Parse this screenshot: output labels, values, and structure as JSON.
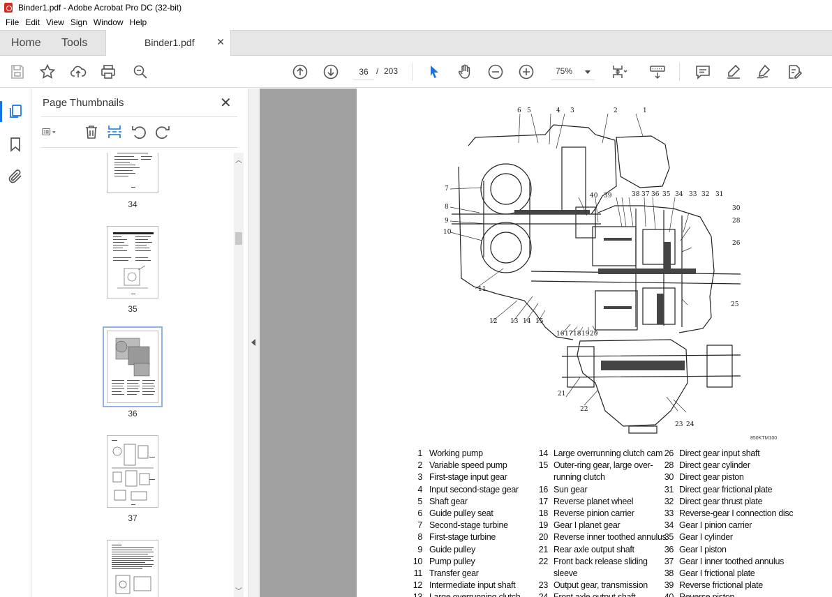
{
  "window": {
    "title": "Binder1.pdf - Adobe Acrobat Pro DC (32-bit)"
  },
  "menu": [
    "File",
    "Edit",
    "View",
    "Sign",
    "Window",
    "Help"
  ],
  "tabs": {
    "home": "Home",
    "tools": "Tools",
    "document": "Binder1.pdf"
  },
  "toolbar": {
    "current_page": "36",
    "page_separator": "/",
    "total_pages": "203",
    "zoom": "75%"
  },
  "panel": {
    "title": "Page Thumbnails",
    "thumbnails": [
      {
        "label": "34"
      },
      {
        "label": "35"
      },
      {
        "label": "36",
        "selected": true
      },
      {
        "label": "37"
      },
      {
        "label": ""
      }
    ]
  },
  "document": {
    "figure_code": "850KTM100",
    "callouts": [
      "1",
      "2",
      "3",
      "4",
      "5",
      "6",
      "7",
      "8",
      "9",
      "10",
      "11",
      "12",
      "13",
      "14",
      "15",
      "16",
      "17",
      "18",
      "19",
      "20",
      "21",
      "22",
      "23",
      "24",
      "25",
      "26",
      "28",
      "30",
      "31",
      "32",
      "33",
      "34",
      "35",
      "36",
      "37",
      "38",
      "39",
      "40"
    ],
    "legend_col1": [
      {
        "n": "1",
        "t": "Working pump"
      },
      {
        "n": "2",
        "t": "Variable speed pump"
      },
      {
        "n": "3",
        "t": "First-stage input gear"
      },
      {
        "n": "4",
        "t": "Input second-stage gear"
      },
      {
        "n": "5",
        "t": "Shaft gear"
      },
      {
        "n": "6",
        "t": "Guide pulley seat"
      },
      {
        "n": "7",
        "t": "Second-stage turbine"
      },
      {
        "n": "8",
        "t": "First-stage turbine"
      },
      {
        "n": "9",
        "t": "Guide pulley"
      },
      {
        "n": "10",
        "t": "Pump pulley"
      },
      {
        "n": "11",
        "t": "Transfer gear"
      },
      {
        "n": "12",
        "t": "Intermediate input shaft"
      },
      {
        "n": "13",
        "t": "Large overrunning clutch"
      }
    ],
    "legend_col2": [
      {
        "n": "14",
        "t": "Large overrunning clutch cam"
      },
      {
        "n": "15",
        "t": "Outer-ring gear, large over-"
      },
      {
        "n": "",
        "t": "running clutch"
      },
      {
        "n": "16",
        "t": "Sun gear"
      },
      {
        "n": "17",
        "t": "Reverse planet wheel"
      },
      {
        "n": "18",
        "t": "Reverse pinion carrier"
      },
      {
        "n": "19",
        "t": "Gear I planet gear"
      },
      {
        "n": "20",
        "t": "Reverse inner toothed annulus"
      },
      {
        "n": "21",
        "t": "Rear axle output shaft"
      },
      {
        "n": "22",
        "t": "Front back release sliding"
      },
      {
        "n": "",
        "t": "sleeve"
      },
      {
        "n": "23",
        "t": "Output gear, transmission"
      },
      {
        "n": "24",
        "t": "Front axle output shaft"
      }
    ],
    "legend_col3": [
      {
        "n": "26",
        "t": "Direct gear input shaft"
      },
      {
        "n": "28",
        "t": "Direct gear cylinder"
      },
      {
        "n": "30",
        "t": "Direct gear piston"
      },
      {
        "n": "31",
        "t": "Direct gear frictional plate"
      },
      {
        "n": "32",
        "t": "Direct gear thrust plate"
      },
      {
        "n": "33",
        "t": "Reverse-gear I connection disc"
      },
      {
        "n": "34",
        "t": "Gear I pinion carrier"
      },
      {
        "n": "35",
        "t": "Gear I cylinder"
      },
      {
        "n": "36",
        "t": "Gear I piston"
      },
      {
        "n": "37",
        "t": "Gear I inner toothed annulus"
      },
      {
        "n": "38",
        "t": "Gear I frictional plate"
      },
      {
        "n": "39",
        "t": "Reverse frictional plate"
      },
      {
        "n": "40",
        "t": "Reverse piston"
      }
    ]
  }
}
